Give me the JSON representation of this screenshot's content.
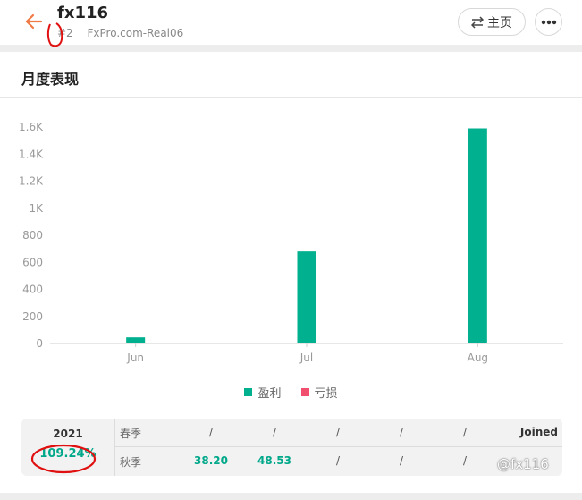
{
  "header": {
    "title": "fx116",
    "rank": "#2",
    "server": "FxPro.com-Real06",
    "home_label": "主页",
    "back_icon": "arrow-left-icon",
    "home_icon": "swap-arrows-icon",
    "more_icon": "more-dots-icon"
  },
  "section": {
    "title": "月度表现"
  },
  "chart_data": {
    "type": "bar",
    "categories": [
      "Jun",
      "Jul",
      "Aug"
    ],
    "series": [
      {
        "name": "盈利",
        "color": "#00b08e",
        "values": [
          45,
          680,
          1590
        ]
      },
      {
        "name": "亏损",
        "color": "#f0506e",
        "values": [
          0,
          0,
          0
        ]
      }
    ],
    "y_ticks": [
      "0",
      "200",
      "400",
      "600",
      "800",
      "1K",
      "1.2K",
      "1.4K",
      "1.6K"
    ],
    "ylim": [
      0,
      1600
    ],
    "grid": false,
    "legend_position": "bottom-center"
  },
  "legend": {
    "profit": "盈利",
    "loss": "亏损"
  },
  "summary": {
    "year": "2021",
    "year_return": "109.24%",
    "rows": [
      {
        "label": "春季",
        "cells": [
          "/",
          "/",
          "/",
          "/",
          "/"
        ],
        "joined": "Joined"
      },
      {
        "label": "秋季",
        "cells": [
          "38.20",
          "48.53",
          "/",
          "/",
          "/"
        ]
      }
    ]
  },
  "watermark": "@fx116"
}
